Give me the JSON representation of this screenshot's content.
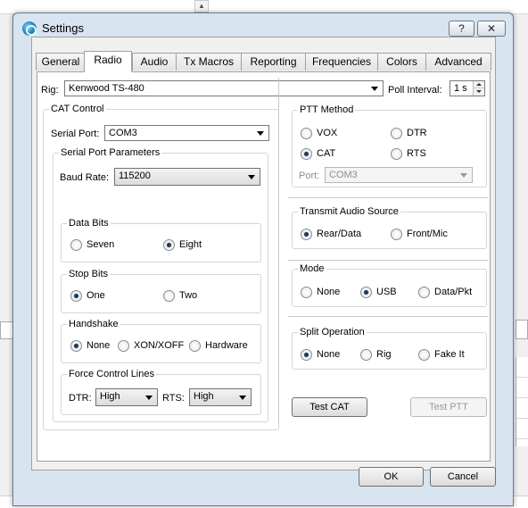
{
  "window": {
    "title": "Settings",
    "help_label": "?",
    "close_label": "✕"
  },
  "tabs": [
    "General",
    "Radio",
    "Audio",
    "Tx Macros",
    "Reporting",
    "Frequencies",
    "Colors",
    "Advanced"
  ],
  "active_tab": "Radio",
  "rig": {
    "label": "Rig:",
    "value": "Kenwood TS-480",
    "poll_label": "Poll Interval:",
    "poll_value": "1 s"
  },
  "cat_control": {
    "title": "CAT Control",
    "serial_port_label": "Serial Port:",
    "serial_port_value": "COM3",
    "serial_params_title": "Serial Port Parameters",
    "baud_rate_label": "Baud Rate:",
    "baud_rate_value": "115200",
    "data_bits": {
      "title": "Data Bits",
      "options": [
        "Seven",
        "Eight"
      ],
      "selected": "Eight"
    },
    "stop_bits": {
      "title": "Stop Bits",
      "options": [
        "One",
        "Two"
      ],
      "selected": "One"
    },
    "handshake": {
      "title": "Handshake",
      "options": [
        "None",
        "XON/XOFF",
        "Hardware"
      ],
      "selected": "None"
    },
    "force_lines": {
      "title": "Force Control Lines",
      "dtr_label": "DTR:",
      "dtr_value": "High",
      "rts_label": "RTS:",
      "rts_value": "High"
    }
  },
  "ptt_method": {
    "title": "PTT Method",
    "options": [
      "VOX",
      "DTR",
      "CAT",
      "RTS"
    ],
    "selected": "CAT",
    "port_label": "Port:",
    "port_value": "COM3"
  },
  "transmit_audio": {
    "title": "Transmit Audio Source",
    "options": [
      "Rear/Data",
      "Front/Mic"
    ],
    "selected": "Rear/Data"
  },
  "mode": {
    "title": "Mode",
    "options": [
      "None",
      "USB",
      "Data/Pkt"
    ],
    "selected": "USB"
  },
  "split": {
    "title": "Split Operation",
    "options": [
      "None",
      "Rig",
      "Fake It"
    ],
    "selected": "None"
  },
  "buttons": {
    "test_cat": "Test CAT",
    "test_ptt": "Test PTT",
    "ok": "OK",
    "cancel": "Cancel"
  },
  "background": {
    "scroll_up_arrow": "▲"
  }
}
